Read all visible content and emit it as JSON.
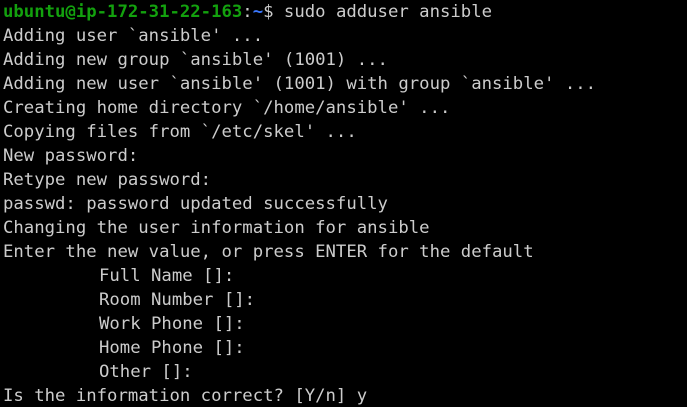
{
  "terminal": {
    "prompt": {
      "user_host": "ubuntu@ip-172-31-22-163",
      "colon": ":",
      "path": "~",
      "symbol": "$ ",
      "command": "sudo adduser ansible"
    },
    "lines": [
      "Adding user `ansible' ...",
      "Adding new group `ansible' (1001) ...",
      "Adding new user `ansible' (1001) with group `ansible' ...",
      "Creating home directory `/home/ansible' ...",
      "Copying files from `/etc/skel' ...",
      "New password:",
      "Retype new password:",
      "passwd: password updated successfully",
      "Changing the user information for ansible",
      "Enter the new value, or press ENTER for the default"
    ],
    "fields": [
      "Full Name []:",
      "Room Number []:",
      "Work Phone []:",
      "Home Phone []:",
      "Other []:"
    ],
    "confirm": "Is the information correct? [Y/n] y"
  },
  "colors": {
    "background": "#000000",
    "text": "#cccccc",
    "prompt_user": "#13a10e",
    "prompt_path": "#3b78ff"
  }
}
